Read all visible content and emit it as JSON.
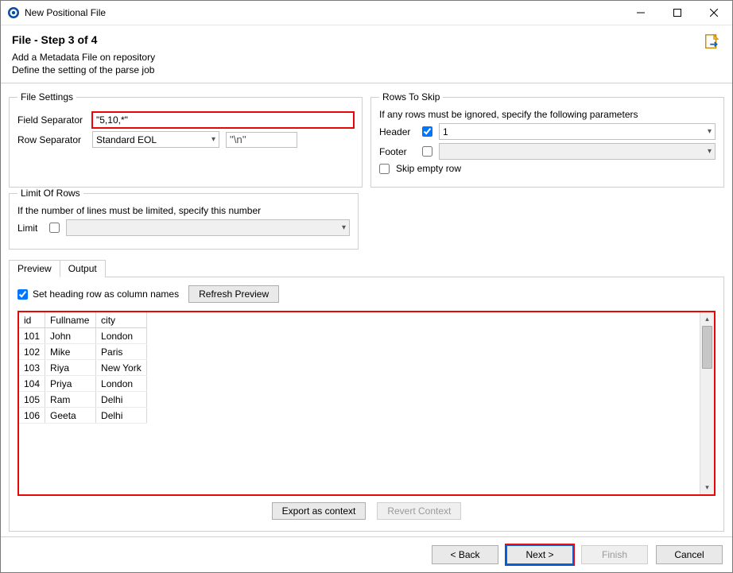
{
  "window": {
    "title": "New Positional File"
  },
  "header": {
    "title": "File - Step 3 of 4",
    "line1": "Add a Metadata File on repository",
    "line2": "Define the setting of the parse job"
  },
  "file_settings": {
    "legend": "File Settings",
    "field_separator_label": "Field Separator",
    "field_separator_value": "\"5,10,*\"",
    "row_separator_label": "Row Separator",
    "row_separator_value": "Standard EOL",
    "row_separator_literal": "\"\\n\""
  },
  "rows_to_skip": {
    "legend": "Rows To Skip",
    "hint": "If any rows must be ignored, specify the following parameters",
    "header_label": "Header",
    "header_checked": true,
    "header_value": "1",
    "footer_label": "Footer",
    "footer_checked": false,
    "footer_value": "",
    "skip_empty_label": "Skip empty row",
    "skip_empty_checked": false
  },
  "limit": {
    "legend": "Limit Of Rows",
    "hint": "If the number of lines must be limited, specify this number",
    "label": "Limit",
    "checked": false,
    "value": ""
  },
  "tabs": {
    "preview": "Preview",
    "output": "Output"
  },
  "preview_panel": {
    "heading_checkbox_label": "Set heading row as column names",
    "heading_checked": true,
    "refresh_label": "Refresh Preview"
  },
  "chart_data": {
    "type": "table",
    "columns": [
      "id",
      "Fullname",
      "city"
    ],
    "rows": [
      [
        "101",
        "John",
        "London"
      ],
      [
        "102",
        "Mike",
        "Paris"
      ],
      [
        "103",
        "Riya",
        "New York"
      ],
      [
        "104",
        "Priya",
        "London"
      ],
      [
        "105",
        "Ram",
        "Delhi"
      ],
      [
        "106",
        "Geeta",
        "Delhi"
      ]
    ]
  },
  "context_buttons": {
    "export": "Export as context",
    "revert": "Revert Context"
  },
  "footer": {
    "back": "< Back",
    "next": "Next >",
    "finish": "Finish",
    "cancel": "Cancel"
  }
}
